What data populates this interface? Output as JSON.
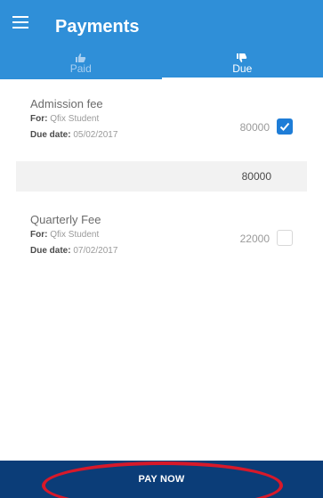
{
  "header": {
    "title": "Payments",
    "menu_icon": "hamburger-menu-icon",
    "background": "#2f8fd8"
  },
  "tabs": [
    {
      "label": "Paid",
      "icon": "thumbs-up-icon",
      "active": false
    },
    {
      "label": "Due",
      "icon": "thumbs-down-icon",
      "active": true
    }
  ],
  "fees": [
    {
      "name": "Admission fee",
      "for_label": "For:",
      "for_value": "Qfix Student",
      "due_label": "Due date:",
      "due_value": "05/02/2017",
      "amount": "80000",
      "checked": true
    },
    {
      "name": "Quarterly Fee",
      "for_label": "For:",
      "for_value": "Qfix Student",
      "due_label": "Due date:",
      "due_value": "07/02/2017",
      "amount": "22000",
      "checked": false
    }
  ],
  "subtotal": {
    "amount": "80000"
  },
  "footer": {
    "pay_label": "PAY NOW",
    "background": "#0b3d78",
    "highlight_color": "#d7192a"
  }
}
